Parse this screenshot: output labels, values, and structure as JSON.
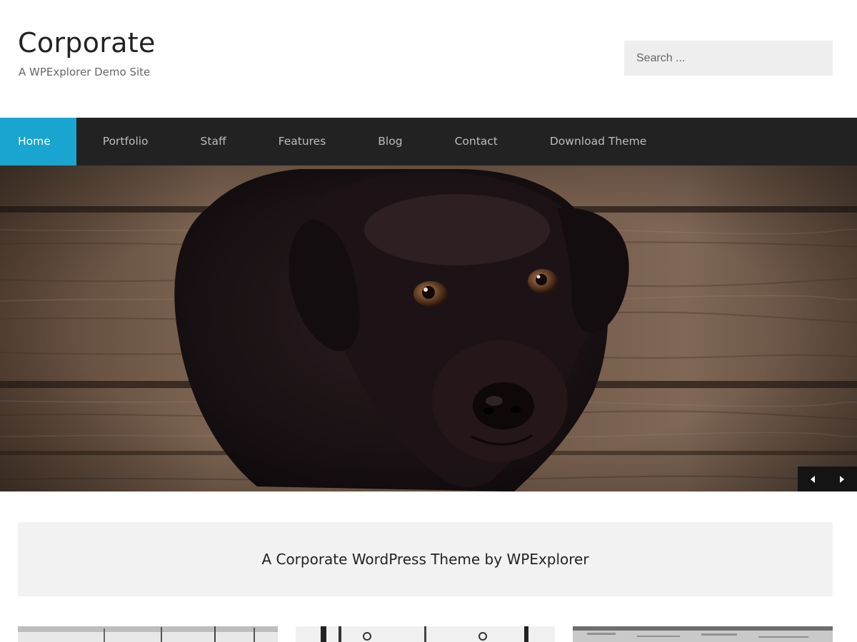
{
  "site": {
    "title": "Corporate",
    "tagline": "A WPExplorer Demo Site"
  },
  "search": {
    "placeholder": "Search ..."
  },
  "nav": {
    "items": [
      {
        "label": "Home",
        "active": true
      },
      {
        "label": "Portfolio",
        "active": false
      },
      {
        "label": "Staff",
        "active": false
      },
      {
        "label": "Features",
        "active": false
      },
      {
        "label": "Blog",
        "active": false
      },
      {
        "label": "Contact",
        "active": false
      },
      {
        "label": "Download Theme",
        "active": false
      }
    ]
  },
  "hero": {
    "image": "black-puppy-on-wooden-floor",
    "prev_icon": "triangle-left",
    "next_icon": "triangle-right"
  },
  "intro": {
    "text": "A Corporate WordPress Theme by WPExplorer"
  },
  "thumbnails": [
    {
      "image": "grayscale-landscape-photo"
    },
    {
      "image": "grayscale-interior-photo"
    },
    {
      "image": "grayscale-texture-photo"
    }
  ],
  "colors": {
    "accent": "#1aa5d1",
    "nav_background": "#222222",
    "nav_text": "#bdbdbd",
    "search_background": "#eeeeee",
    "intro_background": "#f2f2f2"
  }
}
